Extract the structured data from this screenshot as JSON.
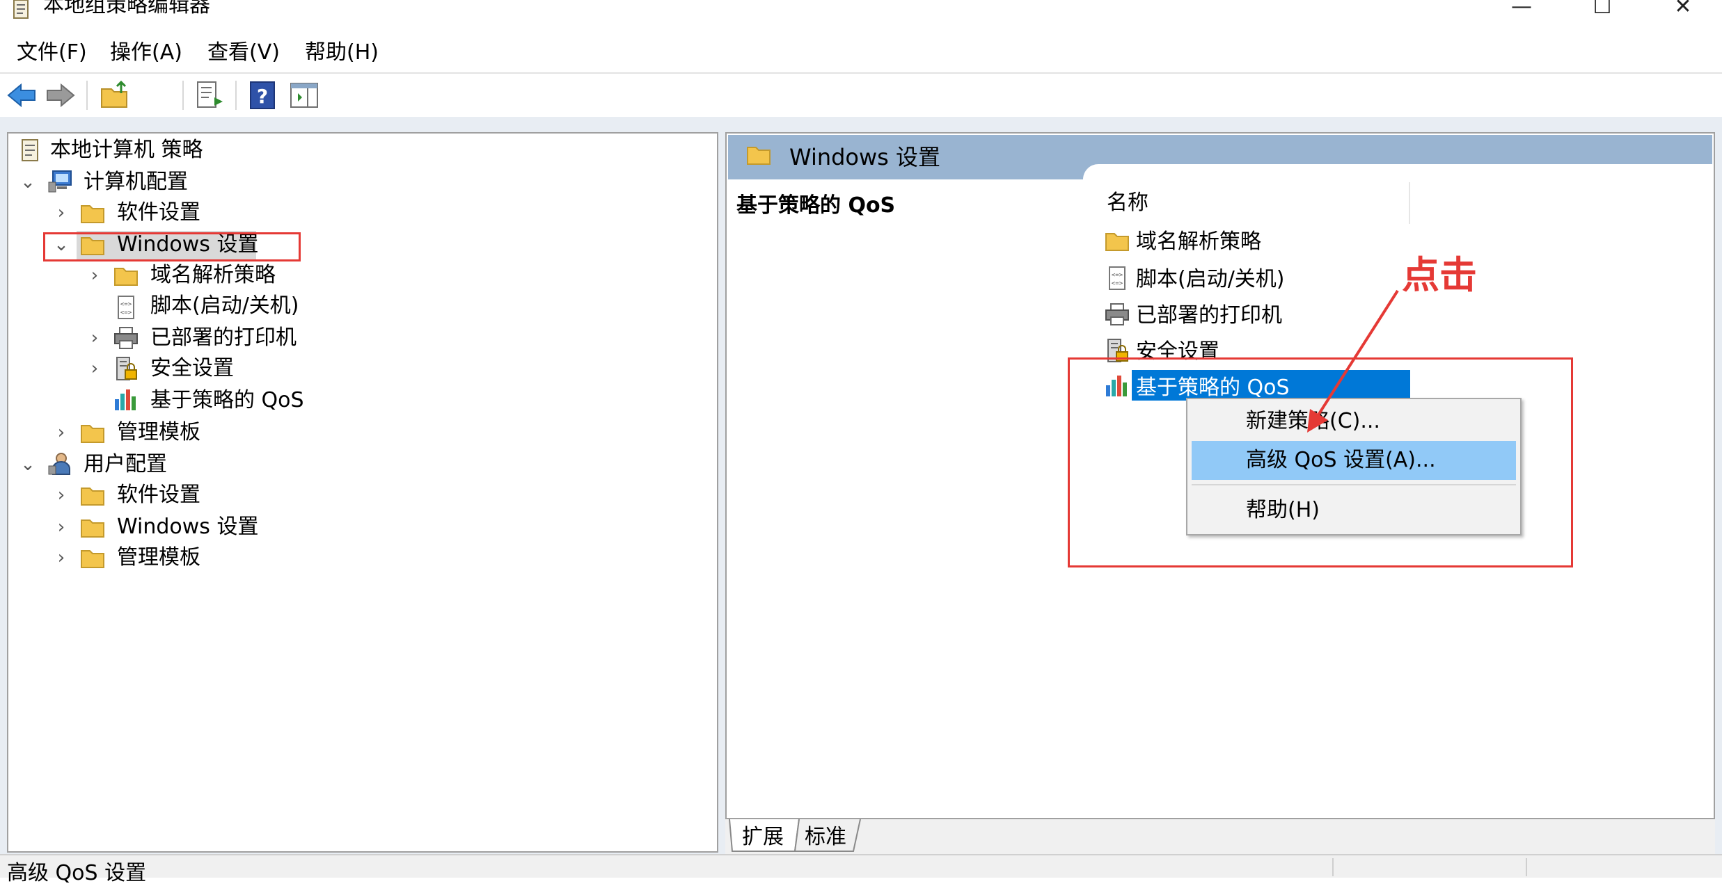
{
  "window": {
    "title": "本地组策略编辑器",
    "controls": {
      "minimize": "—",
      "maximize": "☐",
      "close": "✕"
    }
  },
  "menu": {
    "items": [
      "文件(F)",
      "操作(A)",
      "查看(V)",
      "帮助(H)"
    ]
  },
  "toolbar": {
    "buttons": [
      "back-icon",
      "forward-icon",
      "up-folder-icon",
      "show-hide-tree-icon",
      "export-list-icon",
      "help-icon",
      "show-action-pane-icon"
    ]
  },
  "tree": {
    "root": "本地计算机 策略",
    "computer_config": "计算机配置",
    "cc_software": "软件设置",
    "cc_windows": "Windows 设置",
    "cc_dns": "域名解析策略",
    "cc_scripts": "脚本(启动/关机)",
    "cc_printers": "已部署的打印机",
    "cc_security": "安全设置",
    "cc_qos": "基于策略的 QoS",
    "cc_admin": "管理模板",
    "user_config": "用户配置",
    "uc_software": "软件设置",
    "uc_windows": "Windows 设置",
    "uc_admin": "管理模板"
  },
  "right": {
    "header_title": "Windows 设置",
    "detail_title": "基于策略的 QoS",
    "column_name": "名称",
    "items": [
      "域名解析策略",
      "脚本(启动/关机)",
      "已部署的打印机",
      "安全设置",
      "基于策略的 QoS"
    ]
  },
  "context_menu": {
    "items": [
      "新建策略(C)...",
      "高级 QoS 设置(A)...",
      "帮助(H)"
    ]
  },
  "tabs": [
    "扩展",
    "标准"
  ],
  "status": "高级 QoS 设置",
  "annotation": {
    "label": "点击",
    "color": "#e53935"
  },
  "colors": {
    "selection": "#0078d7",
    "menu_hover": "#91c9f7",
    "header_band": "#99b4d1"
  }
}
